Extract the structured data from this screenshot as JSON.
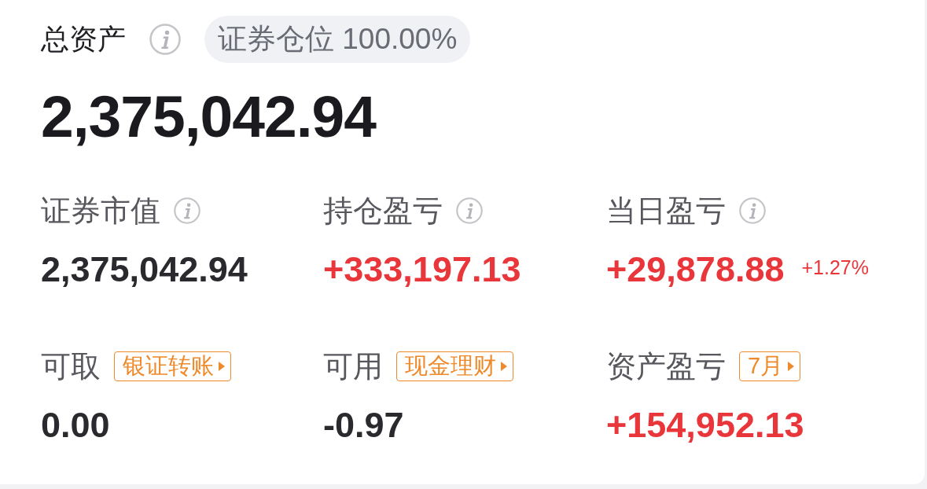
{
  "header": {
    "title": "总资产",
    "position_badge": "证券仓位 100.00%"
  },
  "total": "2,375,042.94",
  "metrics": [
    {
      "label": "证券市值",
      "kind": "info",
      "value": "2,375,042.94",
      "gain": false
    },
    {
      "label": "持仓盈亏",
      "kind": "info",
      "value": "+333,197.13",
      "gain": true
    },
    {
      "label": "当日盈亏",
      "kind": "info",
      "value": "+29,878.88",
      "gain": true,
      "change": "+1.27%"
    },
    {
      "label": "可取",
      "kind": "link",
      "link": "银证转账",
      "value": "0.00",
      "gain": false
    },
    {
      "label": "可用",
      "kind": "link",
      "link": "现金理财",
      "value": "-0.97",
      "gain": false
    },
    {
      "label": "资产盈亏",
      "kind": "link",
      "link": "7月",
      "value": "+154,952.13",
      "gain": true
    }
  ]
}
